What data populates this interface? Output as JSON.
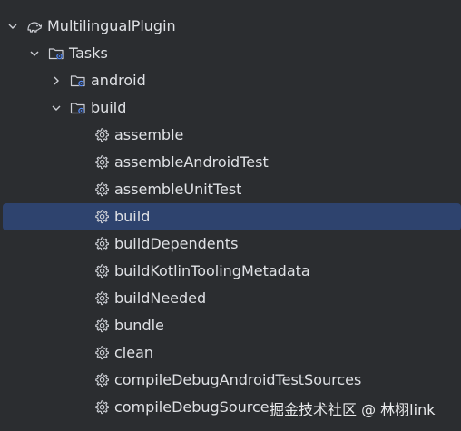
{
  "tree": {
    "root": {
      "label": "MultilingualPlugin",
      "icon": "elephant-icon",
      "expanded": true
    },
    "tasks_group": {
      "label": "Tasks",
      "icon": "folder-gear-icon",
      "expanded": true
    },
    "groups": [
      {
        "label": "android",
        "icon": "folder-gear-icon",
        "expanded": false
      },
      {
        "label": "build",
        "icon": "folder-gear-icon",
        "expanded": true
      }
    ],
    "build_tasks": [
      {
        "label": "assemble",
        "icon": "gear-icon",
        "selected": false
      },
      {
        "label": "assembleAndroidTest",
        "icon": "gear-icon",
        "selected": false
      },
      {
        "label": "assembleUnitTest",
        "icon": "gear-icon",
        "selected": false
      },
      {
        "label": "build",
        "icon": "gear-icon",
        "selected": true
      },
      {
        "label": "buildDependents",
        "icon": "gear-icon",
        "selected": false
      },
      {
        "label": "buildKotlinToolingMetadata",
        "icon": "gear-icon",
        "selected": false
      },
      {
        "label": "buildNeeded",
        "icon": "gear-icon",
        "selected": false
      },
      {
        "label": "bundle",
        "icon": "gear-icon",
        "selected": false
      },
      {
        "label": "clean",
        "icon": "gear-icon",
        "selected": false
      },
      {
        "label": "compileDebugAndroidTestSources",
        "icon": "gear-icon",
        "selected": false
      },
      {
        "label": "compileDebugSource",
        "icon": "gear-icon",
        "selected": false
      }
    ]
  },
  "watermark": "掘金技术社区 @ 林栩link",
  "colors": {
    "background": "#2b2d30",
    "text": "#dfe1e5",
    "selection": "#2e436e",
    "icon": "#ced0d6",
    "folder_badge": "#548af7"
  }
}
